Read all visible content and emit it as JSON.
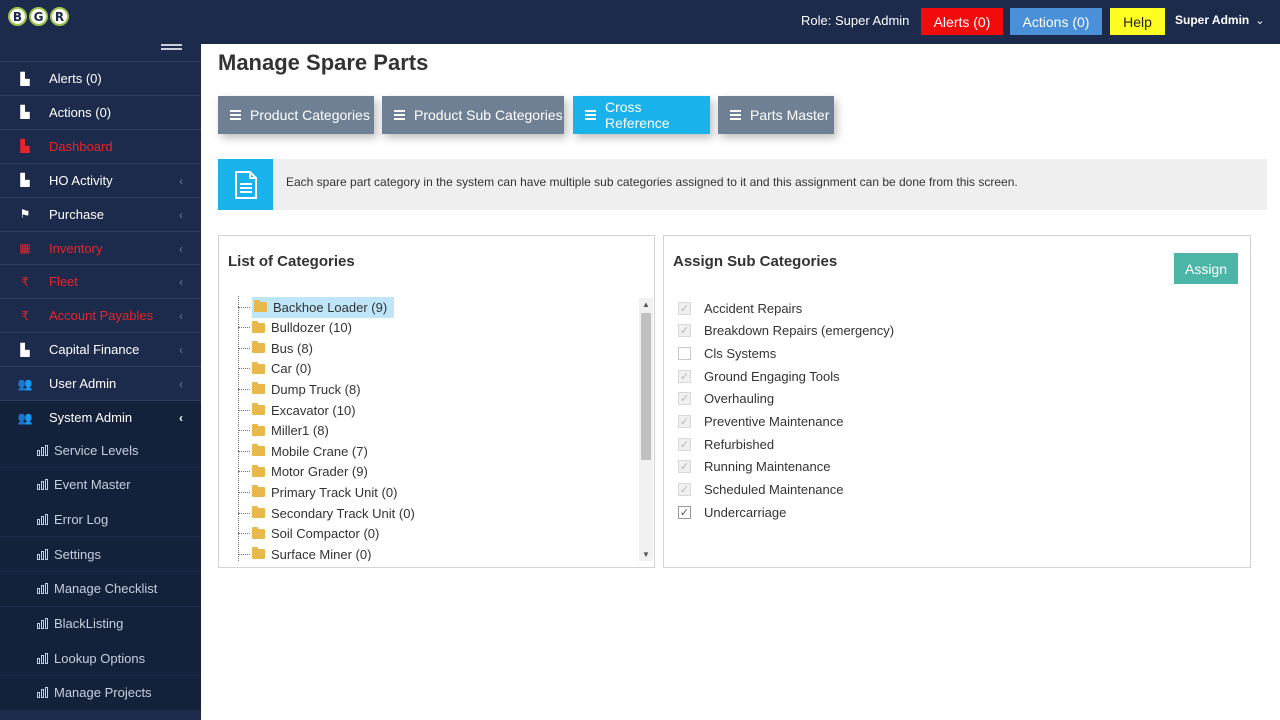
{
  "logo": {
    "letters": [
      "B",
      "G",
      "R"
    ]
  },
  "header": {
    "role_text": "Role: Super Admin",
    "alerts_btn": "Alerts (0)",
    "actions_btn": "Actions (0)",
    "help_btn": "Help",
    "user_name": "Super Admin",
    "user_caret": "⌄"
  },
  "sidebar": {
    "items": [
      {
        "label": "Alerts (0)",
        "icon": "area-chart-icon",
        "red": false
      },
      {
        "label": "Actions (0)",
        "icon": "area-chart-icon",
        "red": false
      },
      {
        "label": "Dashboard",
        "icon": "area-chart-icon",
        "red": true
      },
      {
        "label": "HO Activity",
        "icon": "area-chart-icon",
        "red": false
      },
      {
        "label": "Purchase",
        "icon": "flag-icon",
        "red": false
      },
      {
        "label": "Inventory",
        "icon": "calculator-icon",
        "red": true
      },
      {
        "label": "Fleet",
        "icon": "rupee-icon",
        "red": true
      },
      {
        "label": "Account Payables",
        "icon": "rupee-icon",
        "red": true
      },
      {
        "label": "Capital Finance",
        "icon": "area-chart-icon",
        "red": false
      },
      {
        "label": "User Admin",
        "icon": "users-icon",
        "red": false
      },
      {
        "label": "System Admin",
        "icon": "users-icon",
        "red": false
      }
    ],
    "sub_items": [
      "Service Levels",
      "Event Master",
      "Error Log",
      "Settings",
      "Manage Checklist",
      "BlackListing",
      "Lookup Options",
      "Manage Projects"
    ]
  },
  "page": {
    "title": "Manage Spare Parts",
    "tabs": [
      "Product Categories",
      "Product Sub Categories",
      "Cross Reference",
      "Parts Master"
    ],
    "active_tab": "Cross Reference",
    "info_text": "Each spare part category in the system can have multiple sub categories assigned to it and this assignment can be done from this screen."
  },
  "categories_panel": {
    "title": "List of Categories",
    "items": [
      "Backhoe Loader (9)",
      "Bulldozer (10)",
      "Bus (8)",
      "Car (0)",
      "Dump Truck (8)",
      "Excavator (10)",
      "Miller1 (8)",
      "Mobile Crane (7)",
      "Motor Grader (9)",
      "Primary Track Unit (0)",
      "Secondary Track Unit (0)",
      "Soil Compactor (0)",
      "Surface Miner (0)"
    ],
    "selected": "Backhoe Loader (9)"
  },
  "assign_panel": {
    "title": "Assign Sub Categories",
    "assign_btn": "Assign",
    "items": [
      {
        "label": "Accident Repairs",
        "checked": true,
        "disabled": true
      },
      {
        "label": "Breakdown Repairs (emergency)",
        "checked": true,
        "disabled": true
      },
      {
        "label": "Cls Systems",
        "checked": false,
        "disabled": false
      },
      {
        "label": "Ground Engaging Tools",
        "checked": true,
        "disabled": true
      },
      {
        "label": "Overhauling",
        "checked": true,
        "disabled": true
      },
      {
        "label": "Preventive Maintenance",
        "checked": true,
        "disabled": true
      },
      {
        "label": "Refurbished",
        "checked": true,
        "disabled": true
      },
      {
        "label": "Running Maintenance",
        "checked": true,
        "disabled": true
      },
      {
        "label": "Scheduled Maintenance",
        "checked": true,
        "disabled": true
      },
      {
        "label": "Undercarriage",
        "checked": true,
        "disabled": false
      }
    ]
  }
}
